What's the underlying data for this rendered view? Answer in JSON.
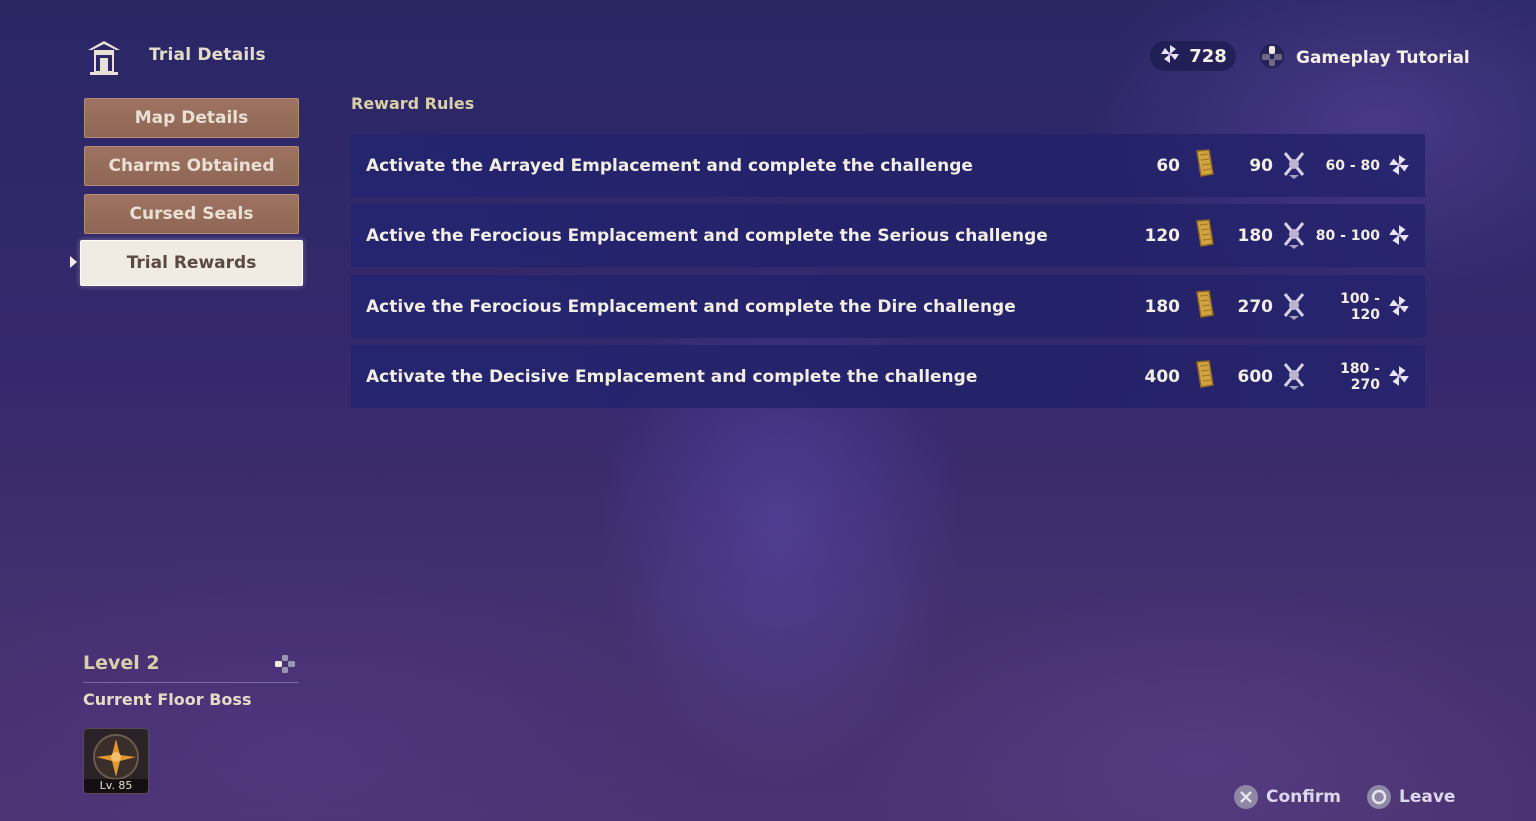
{
  "header": {
    "title": "Trial Details",
    "currency_amount": "728",
    "tutorial_label": "Gameplay Tutorial"
  },
  "menu": {
    "items": [
      {
        "label": "Map Details",
        "active": false
      },
      {
        "label": "Charms Obtained",
        "active": false
      },
      {
        "label": "Cursed Seals",
        "active": false
      },
      {
        "label": "Trial Rewards",
        "active": true
      }
    ]
  },
  "rewards": {
    "section_title": "Reward Rules",
    "rows": [
      {
        "text": "Activate the Arrayed Emplacement and complete the challenge",
        "reward_1": "60",
        "reward_2": "90",
        "reward_3_line1": "60 - 80",
        "reward_3_line2": ""
      },
      {
        "text": "Active the Ferocious Emplacement and complete the Serious challenge",
        "reward_1": "120",
        "reward_2": "180",
        "reward_3_line1": "80 - 100",
        "reward_3_line2": ""
      },
      {
        "text": "Active the Ferocious Emplacement and complete the Dire challenge",
        "reward_1": "180",
        "reward_2": "270",
        "reward_3_line1": "100 -",
        "reward_3_line2": "120"
      },
      {
        "text": "Activate the Decisive Emplacement and complete the challenge",
        "reward_1": "400",
        "reward_2": "600",
        "reward_3_line1": "180 -",
        "reward_3_line2": "270"
      }
    ],
    "icons": {
      "reward_1": "golden-ticket-icon",
      "reward_2": "crossed-sword-badge-icon",
      "reward_3": "pinwheel-token-icon"
    }
  },
  "level": {
    "label": "Level 2",
    "floor_boss_label": "Current Floor Boss",
    "boss_level": "Lv. 85"
  },
  "footer": {
    "confirm_label": "Confirm",
    "leave_label": "Leave"
  },
  "colors": {
    "menu_button": "#9e7362",
    "menu_active": "#f1ece3",
    "row_background": "#242470",
    "title_gold": "#d9cfa8"
  }
}
